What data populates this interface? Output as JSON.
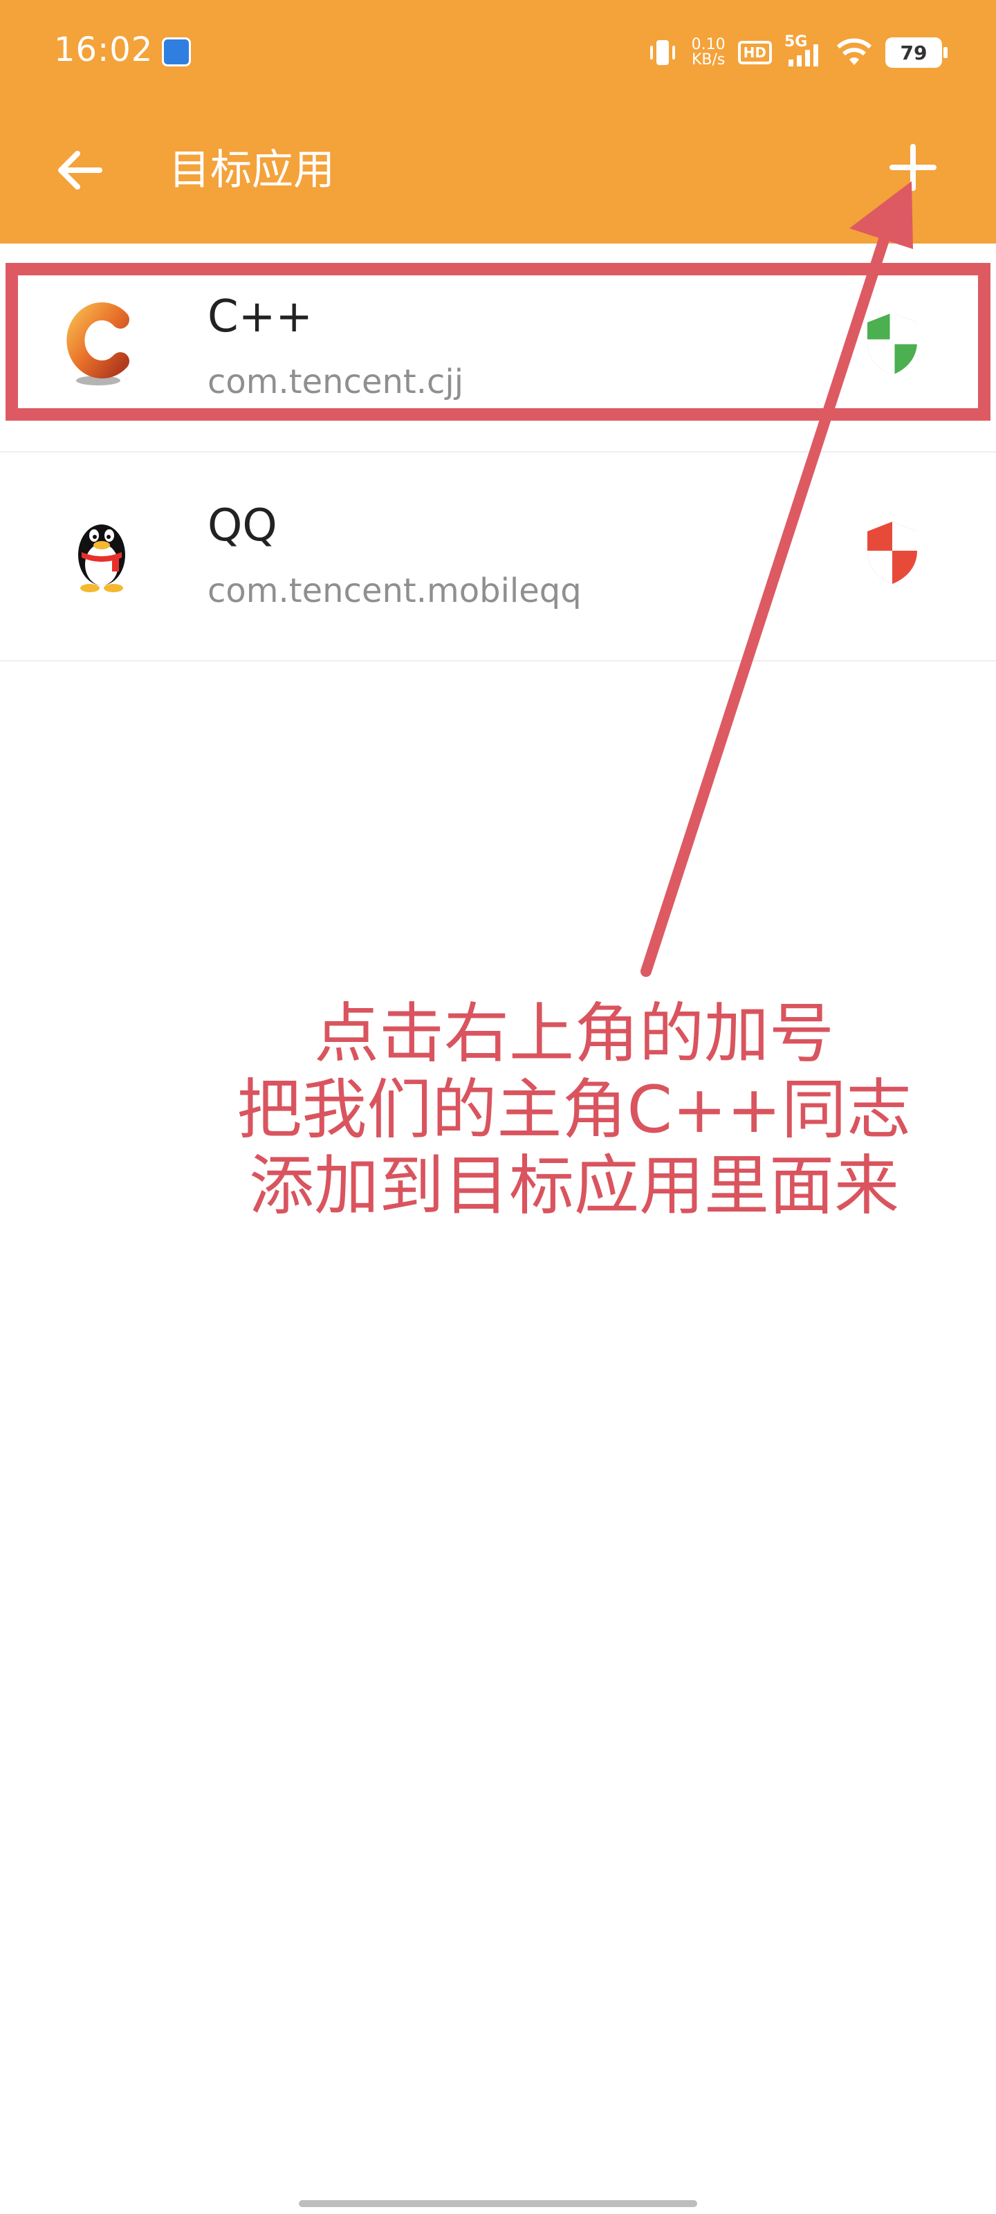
{
  "status_bar": {
    "time": "16:02",
    "net_speed_value": "0.10",
    "net_speed_unit": "KB/s",
    "hd_label": "HD",
    "network_label": "5G",
    "battery": "79",
    "icons": [
      "vibrate-icon",
      "signal-icon",
      "wifi-icon",
      "battery-icon"
    ]
  },
  "app_bar": {
    "title": "目标应用",
    "back_icon": "arrow-left-icon",
    "add_icon": "plus-icon",
    "background": "#f4a23a"
  },
  "apps": [
    {
      "name": "C++",
      "package": "com.tencent.cjj",
      "shield": "green",
      "shield_color": "#4caf50",
      "icon": "cpp-app-icon"
    },
    {
      "name": "QQ",
      "package": "com.tencent.mobileqq",
      "shield": "red",
      "shield_color": "#e84a3a",
      "icon": "qq-penguin-icon"
    }
  ],
  "annotation": {
    "lines": [
      "点击右上角的加号",
      "把我们的主角C++同志",
      "添加到目标应用里面来"
    ],
    "color": "#d9545e"
  }
}
